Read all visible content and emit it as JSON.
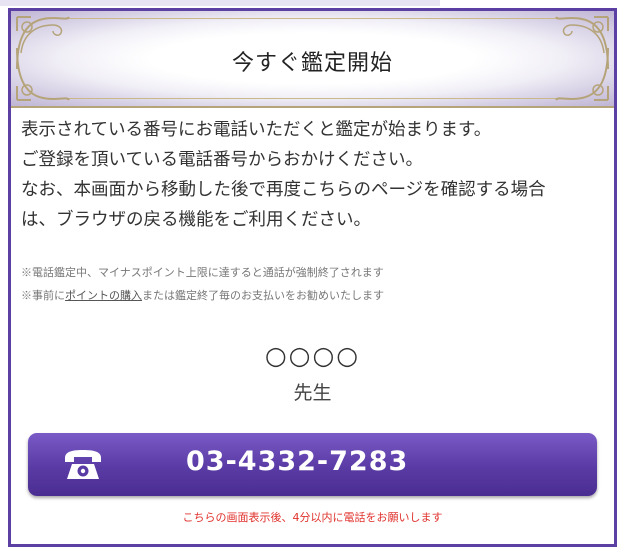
{
  "header": {
    "title": "今すぐ鑑定開始"
  },
  "intro": {
    "lines": [
      "表示されている番号にお電話いただくと鑑定が始まります。",
      "ご登録を頂いている電話番号からおかけください。",
      "なお、本画面から移動した後で再度こちらのページを確認する場合",
      "は、ブラウザの戻る機能をご利用ください。"
    ]
  },
  "notes": {
    "line1": "※電話鑑定中、マイナスポイント上限に達すると通話が強制終了されます",
    "line2_prefix": "※事前に",
    "line2_link": "ポイントの購入",
    "line2_suffix": "または鑑定終了毎のお支払いをお勧めいたします"
  },
  "teacher": {
    "name": "○○○○",
    "title": "先生"
  },
  "call": {
    "icon": "telephone-icon",
    "number": "03-4332-7283"
  },
  "footnote": "こちらの画面表示後、4分以内に電話をお願いします",
  "colors": {
    "accent": "#5b3fa3",
    "button": "#5a3ba5",
    "warning": "#e0322d",
    "gold": "#b5a47a"
  }
}
